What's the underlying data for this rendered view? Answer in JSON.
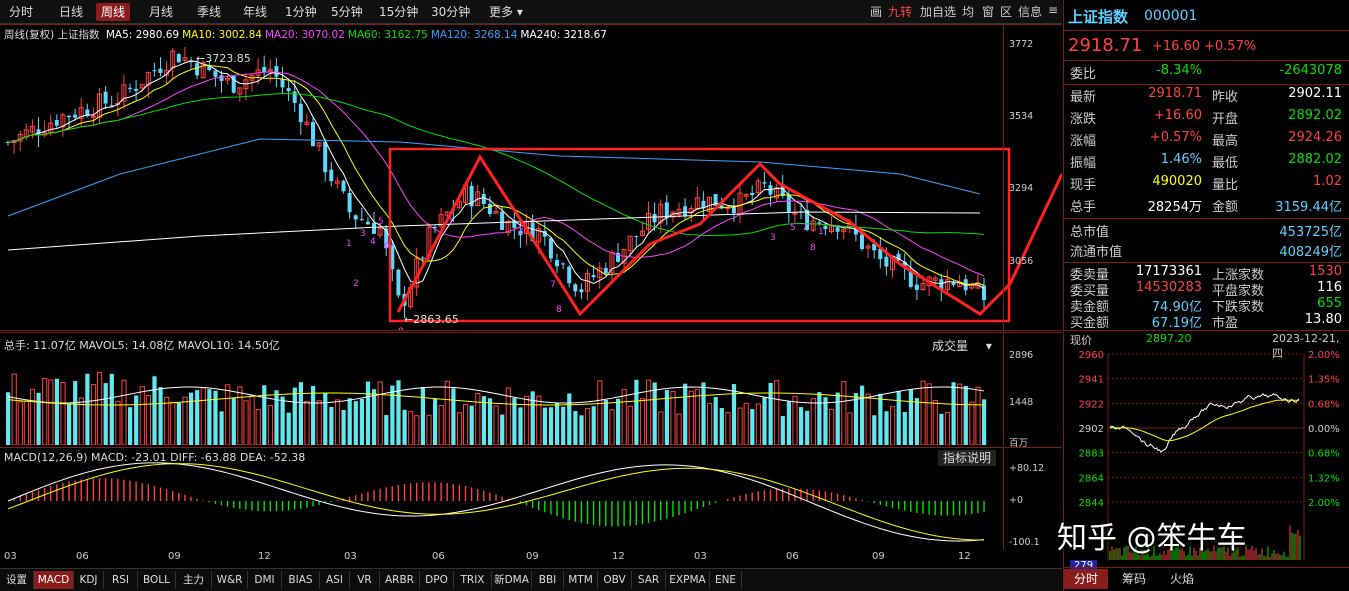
{
  "toolbar": {
    "tabs": [
      "分时",
      "日线",
      "周线",
      "月线",
      "季线",
      "年线",
      "1分钟",
      "5分钟",
      "15分钟",
      "30分钟",
      "更多"
    ],
    "active": "周线",
    "right_items": [
      "画",
      "九转",
      "加自选",
      "均",
      "窗",
      "区",
      "信息"
    ]
  },
  "price_pane": {
    "info_title": "周线(复权) 上证指数",
    "ma": [
      {
        "label": "MA5: 2980.69",
        "color": "#ffffff"
      },
      {
        "label": "MA10: 3002.84",
        "color": "#ffff00"
      },
      {
        "label": "MA20: 3070.02",
        "color": "#ff40ff"
      },
      {
        "label": "MA60: 3162.75",
        "color": "#00e000"
      },
      {
        "label": "MA120: 3268.14",
        "color": "#3aa0ff"
      },
      {
        "label": "MA240: 3218.67",
        "color": "#ffffff"
      }
    ],
    "y_labels": [
      "3772",
      "3534",
      "3294",
      "3056"
    ],
    "high_label": "3723.85",
    "low_label": "2863.65",
    "nine_turn": [
      "1",
      "2",
      "3",
      "4",
      "5",
      "6",
      "7",
      "8"
    ]
  },
  "volume_pane": {
    "info": "总手: 11.07亿 MAVOL5: 14.08亿 MAVOL10: 14.50亿",
    "dropdown": "成交量",
    "y_labels": [
      "2896",
      "1448"
    ],
    "unit": "百万"
  },
  "macd_pane": {
    "info": "MACD(12,26,9) MACD: -23.01 DIFF: -63.88 DEA: -52.38",
    "explain_btn": "指标说明",
    "y_labels": [
      "+80.12",
      "+0",
      "-100.1"
    ]
  },
  "x_axis": [
    "03",
    "06",
    "09",
    "12",
    "03",
    "06",
    "09",
    "12",
    "03",
    "06",
    "09",
    "12"
  ],
  "bottom_tabs": [
    "设置",
    "MACD",
    "KDJ",
    "RSI",
    "BOLL",
    "主力",
    "W&R",
    "DMI",
    "BIAS",
    "ASI",
    "VR",
    "ARBR",
    "DPO",
    "TRIX",
    "新DMA",
    "BBI",
    "MTM",
    "OBV",
    "SAR",
    "EXPMA",
    "ENE"
  ],
  "bottom_active": "MACD",
  "quote": {
    "name": "上证指数",
    "code": "000001",
    "price": "2918.71",
    "change": "+16.60",
    "pct": "+0.57%",
    "weibi_label": "委比",
    "weibi_pct": "-8.34%",
    "weibi_val": "-2643078",
    "rows": [
      {
        "l1": "最新",
        "v1": "2918.71",
        "c1": "red",
        "l2": "昨收",
        "v2": "2902.11",
        "c2": "white"
      },
      {
        "l1": "涨跌",
        "v1": "+16.60",
        "c1": "red",
        "l2": "开盘",
        "v2": "2892.02",
        "c2": "green"
      },
      {
        "l1": "涨幅",
        "v1": "+0.57%",
        "c1": "red",
        "l2": "最高",
        "v2": "2924.26",
        "c2": "red"
      },
      {
        "l1": "振幅",
        "v1": "1.46%",
        "c1": "cyan",
        "l2": "最低",
        "v2": "2882.02",
        "c2": "green"
      },
      {
        "l1": "现手",
        "v1": "490020",
        "c1": "yellow",
        "l2": "量比",
        "v2": "1.02",
        "c2": "red"
      },
      {
        "l1": "总手",
        "v1": "28254万",
        "c1": "white",
        "l2": "金额",
        "v2": "3159.44亿",
        "c2": "cyan"
      }
    ],
    "mcap": [
      {
        "l": "总市值",
        "v": "453725亿"
      },
      {
        "l": "流通市值",
        "v": "408249亿"
      }
    ],
    "stats": [
      {
        "l1": "委卖量",
        "v1": "17173361",
        "c1": "white",
        "l2": "上涨家数",
        "v2": "1530",
        "c2": "red"
      },
      {
        "l1": "委买量",
        "v1": "14530283",
        "c1": "red",
        "l2": "平盘家数",
        "v2": "116",
        "c2": "white"
      },
      {
        "l1": "卖金额",
        "v1": "74.90亿",
        "c1": "cyan",
        "l2": "下跌家数",
        "v2": "655",
        "c2": "green"
      },
      {
        "l1": "买金额",
        "v1": "67.19亿",
        "c1": "cyan",
        "l2": "市盈",
        "v2": "13.80",
        "c2": "white"
      }
    ]
  },
  "mini_chart": {
    "title": "现价",
    "price": "2897.20",
    "date": "2023-12-21,四",
    "y_left": [
      "2960",
      "2941",
      "2922",
      "2902",
      "2883",
      "2864",
      "2844"
    ],
    "y_right": [
      "2.00%",
      "1.35%",
      "0.68%",
      "0.00%",
      "0.68%",
      "1.32%",
      "2.00%"
    ],
    "vol_label": "279",
    "tabs": [
      "分时",
      "筹码",
      "火焰"
    ],
    "active": "分时"
  },
  "watermark": "知乎 @笨牛车",
  "colors": {
    "up": "#ff4040",
    "down": "#5fd8ff",
    "grid": "#7a1a1a",
    "annot": "#ff2020"
  }
}
